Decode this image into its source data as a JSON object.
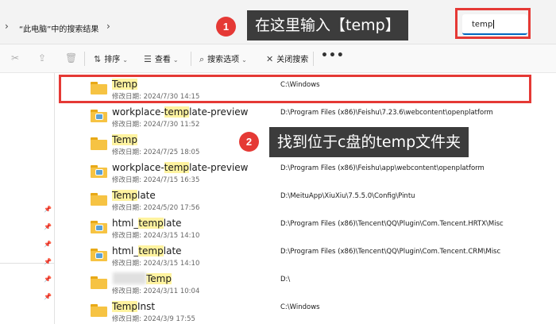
{
  "address_bar": {
    "breadcrumb": "“此电脑”中的搜索结果",
    "search_value": "temp",
    "back_icon": "chevron-left-icon",
    "forward_icon": "chevron-right-icon"
  },
  "callouts": [
    {
      "number": "1",
      "text": "在这里输入【temp】"
    },
    {
      "number": "2",
      "text": "找到位于c盘的temp文件夹"
    }
  ],
  "toolbar": {
    "sort": "排序",
    "view": "查看",
    "search_options": "搜索选项",
    "close_search": "关闭搜索",
    "more": "•••"
  },
  "file_list": {
    "rows": [
      {
        "name_hl": "Temp",
        "name_rest": "",
        "date": "修改日期: 2024/7/30 14:15",
        "path": "C:\\Windows",
        "icon": "folder-icon"
      },
      {
        "name_pre": "workplace-",
        "name_hl": "temp",
        "name_rest": "late-preview",
        "date": "修改日期: 2024/7/30 11:52",
        "path": "D:\\Program Files (x86)\\Feishu\\7.23.6\\webcontent\\openplatform",
        "icon": "folder-image-icon"
      },
      {
        "name_hl": "Temp",
        "name_rest": "",
        "date": "修改日期: 2024/7/25 18:05",
        "path": "",
        "icon": "folder-icon"
      },
      {
        "name_pre": "workplace-",
        "name_hl": "temp",
        "name_rest": "late-preview",
        "date": "修改日期: 2024/7/15 16:35",
        "path": "D:\\Program Files (x86)\\Feishu\\app\\webcontent\\openplatform",
        "icon": "folder-image-icon"
      },
      {
        "name_hl": "Temp",
        "name_rest": "late",
        "date": "修改日期: 2024/5/20 17:56",
        "path": "D:\\MeituApp\\XiuXiu\\7.5.5.0\\Config\\Pintu",
        "icon": "folder-icon"
      },
      {
        "name_pre": "html_",
        "name_hl": "temp",
        "name_rest": "late",
        "date": "修改日期: 2024/3/15 14:10",
        "path": "D:\\Program Files (x86)\\Tencent\\QQ\\Plugin\\Com.Tencent.HRTX\\Misc",
        "icon": "folder-image-icon"
      },
      {
        "name_pre": "html_",
        "name_hl": "temp",
        "name_rest": "late",
        "date": "修改日期: 2024/3/15 14:10",
        "path": "D:\\Program Files (x86)\\Tencent\\QQ\\Plugin\\Com.Tencent.CRM\\Misc",
        "icon": "folder-image-icon"
      },
      {
        "name_pre": "",
        "name_hl": "Temp",
        "name_rest": "",
        "date": "修改日期: 2024/3/11 10:04",
        "path": "D:\\",
        "icon": "folder-icon"
      },
      {
        "name_hl": "Temp",
        "name_rest": "Inst",
        "date": "修改日期: 2024/3/9 17:55",
        "path": "C:\\Windows",
        "icon": "folder-icon"
      }
    ]
  },
  "colors": {
    "annotation_red": "#e53935",
    "highlight": "#fff3a0",
    "callout_bg": "#3c3c3c",
    "folder": "#f6c343"
  }
}
